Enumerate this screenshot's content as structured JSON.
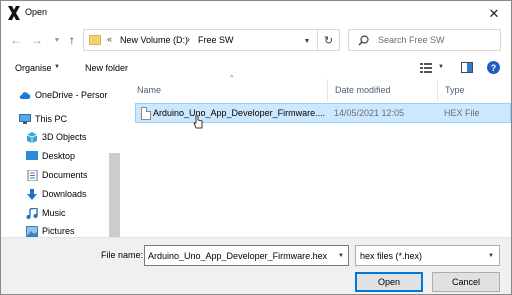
{
  "window": {
    "title": "Open",
    "close_glyph": "✕"
  },
  "icons": {
    "app": "x-app-icon",
    "back": "arrow-left-icon",
    "forward": "arrow-right-icon",
    "up": "arrow-up-icon",
    "refresh": "refresh-icon",
    "search": "search-icon",
    "folder": "folder-icon",
    "help": "help-icon"
  },
  "address": {
    "chevrons": "«",
    "segments": [
      "New Volume (D:)",
      "Free SW"
    ],
    "separator": "›"
  },
  "search": {
    "placeholder": "Search Free SW"
  },
  "toolbar": {
    "organise_label": "Organise",
    "new_folder_label": "New folder",
    "help_glyph": "?"
  },
  "navpane": {
    "items": [
      {
        "label": "OneDrive - Persor",
        "icon": "cloud-icon"
      },
      {
        "label": "This PC",
        "icon": "computer-icon"
      },
      {
        "label": "3D Objects",
        "icon": "cube-icon"
      },
      {
        "label": "Desktop",
        "icon": "desktop-icon"
      },
      {
        "label": "Documents",
        "icon": "document-icon"
      },
      {
        "label": "Downloads",
        "icon": "download-icon"
      },
      {
        "label": "Music",
        "icon": "music-icon"
      },
      {
        "label": "Pictures",
        "icon": "pictures-icon"
      }
    ]
  },
  "filelist": {
    "columns": [
      "Name",
      "Date modified",
      "Type"
    ],
    "rows": [
      {
        "name": "Arduino_Uno_App_Developer_Firmware....",
        "date": "14/05/2021 12:05",
        "type": "HEX File",
        "selected": true
      }
    ]
  },
  "bottom": {
    "filename_label": "File name:",
    "filename_value": "Arduino_Uno_App_Developer_Firmware.hex",
    "filetype_value": "hex files (*.hex)",
    "open_label": "Open",
    "cancel_label": "Cancel"
  },
  "colors": {
    "accent": "#0078d7",
    "selection": "#cce8ff",
    "help": "#1f5fbf"
  }
}
